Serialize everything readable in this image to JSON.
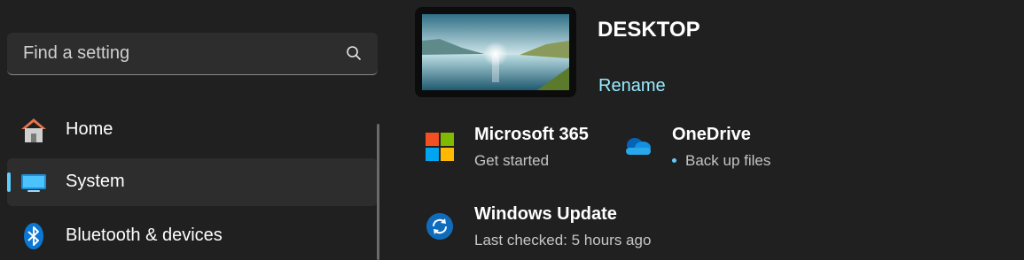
{
  "search": {
    "placeholder": "Find a setting",
    "icon": "search-icon"
  },
  "nav": [
    {
      "label": "Home",
      "icon": "home-icon"
    },
    {
      "label": "System",
      "icon": "system-display-icon",
      "active": true
    },
    {
      "label": "Bluetooth & devices",
      "icon": "bluetooth-icon"
    }
  ],
  "device": {
    "name": "DESKTOP",
    "rename_label": "Rename"
  },
  "cards": {
    "m365": {
      "title": "Microsoft 365",
      "subtitle": "Get started",
      "icon": "microsoft-365-icon"
    },
    "onedrive": {
      "title": "OneDrive",
      "subtitle": "Back up files",
      "icon": "onedrive-icon"
    },
    "update": {
      "title": "Windows Update",
      "subtitle": "Last checked: 5 hours ago",
      "icon": "windows-update-icon"
    }
  },
  "colors": {
    "accent": "#60cdff",
    "link": "#99ebff",
    "background": "#202020"
  }
}
